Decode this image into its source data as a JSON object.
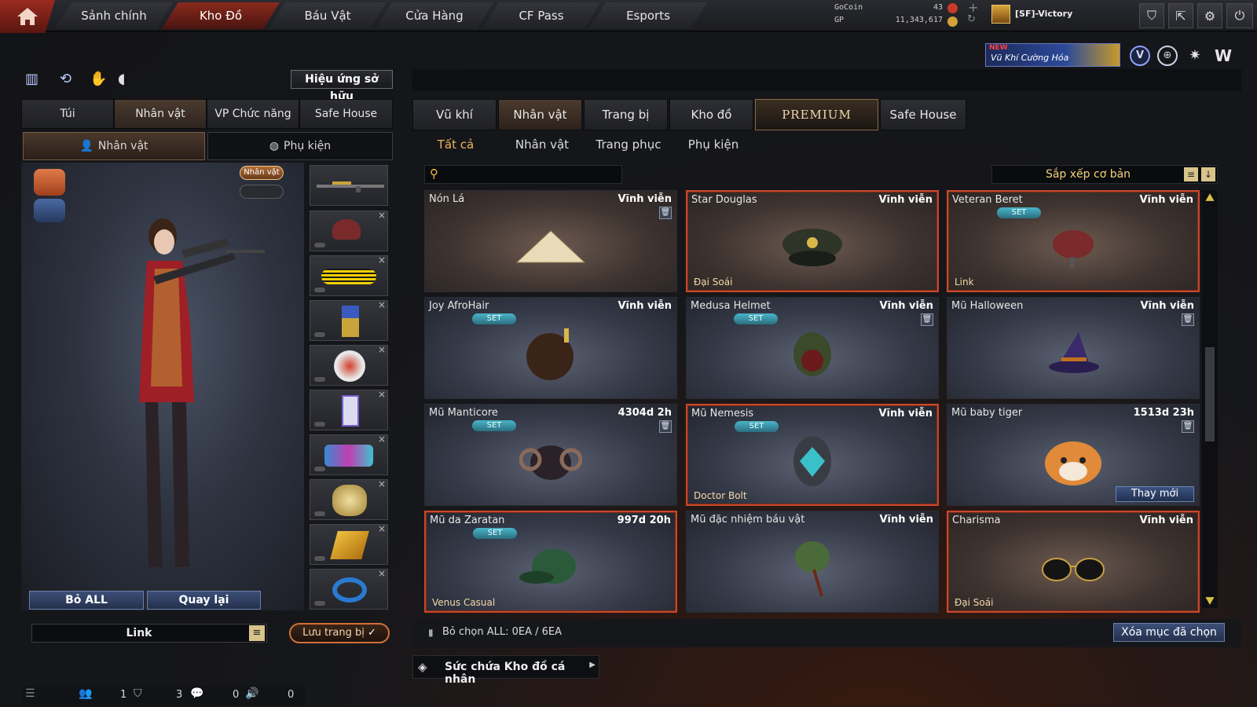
{
  "nav": {
    "tabs": [
      "Sảnh chính",
      "Kho Đồ",
      "Báu Vật",
      "Cửa Hàng",
      "CF Pass",
      "Esports"
    ],
    "active": "Kho Đồ"
  },
  "currency": {
    "gocoin_label": "GoCoin",
    "gocoin_value": "43",
    "gp_label": "GP",
    "gp_value": "11,343,617"
  },
  "user": {
    "name": "[SF]-Victory"
  },
  "banner": {
    "badge": "NEW",
    "text": "Vũ Khí Cường Hóa"
  },
  "left": {
    "effect_button": "Hiệu ứng sở hữu",
    "tabs": [
      "Túi",
      "Nhân vật",
      "VP Chức năng",
      "Safe House"
    ],
    "subtabs": [
      "Nhân vật",
      "Phụ kiện"
    ],
    "char_badge": "Nhân vật",
    "btn_remove_all": "Bỏ ALL",
    "btn_back": "Quay lại",
    "preset_label": "Link",
    "save_label": "Lưu trang bị"
  },
  "right": {
    "tabs": [
      "Vũ khí",
      "Nhân vật",
      "Trang bị",
      "Kho đồ",
      "PREMIUM",
      "Safe House"
    ],
    "subtabs": [
      "Tất cả",
      "Nhân vật",
      "Trang phục",
      "Phụ kiện"
    ],
    "search_placeholder": "",
    "sort_label": "Sắp xếp cơ bản",
    "select_all_text": "Bỏ chọn ALL: 0EA / 6EA",
    "delete_selected": "Xóa mục đã chọn",
    "capacity_label": "Sức chứa Kho đồ cá nhân"
  },
  "items": [
    {
      "name": "Nón Lá",
      "duration": "Vĩnh viễn",
      "set": "",
      "sub": "",
      "trash": true,
      "selected": false,
      "bg": "brown",
      "icon": "conical-hat-icon"
    },
    {
      "name": "Star Douglas",
      "duration": "Vĩnh viễn",
      "set": "",
      "sub": "Đại Soái",
      "trash": false,
      "selected": true,
      "bg": "brown",
      "icon": "officer-cap-icon"
    },
    {
      "name": "Veteran Beret",
      "duration": "Vĩnh viễn",
      "set": "SET",
      "sub": "Link",
      "trash": false,
      "selected": true,
      "bg": "brown",
      "icon": "beret-icon"
    },
    {
      "name": "Joy AfroHair",
      "duration": "Vĩnh viễn",
      "set": "SET",
      "sub": "",
      "trash": false,
      "selected": false,
      "bg": "blue",
      "icon": "afro-hair-icon"
    },
    {
      "name": "Medusa Helmet",
      "duration": "Vĩnh viễn",
      "set": "SET",
      "sub": "",
      "trash": true,
      "selected": false,
      "bg": "blue",
      "icon": "medusa-helmet-icon"
    },
    {
      "name": "Mũ Halloween",
      "duration": "Vĩnh viễn",
      "set": "",
      "sub": "",
      "trash": true,
      "selected": false,
      "bg": "blue",
      "icon": "witch-hat-icon"
    },
    {
      "name": "Mũ Manticore",
      "duration": "4304d 2h",
      "set": "SET",
      "sub": "",
      "trash": true,
      "selected": false,
      "bg": "blue",
      "icon": "manticore-helmet-icon"
    },
    {
      "name": "Mũ Nemesis",
      "duration": "Vĩnh viễn",
      "set": "SET",
      "sub": "Doctor Bolt",
      "trash": false,
      "selected": true,
      "bg": "blue",
      "icon": "nemesis-helmet-icon"
    },
    {
      "name": "Mũ baby tiger",
      "duration": "1513d 23h",
      "set": "",
      "sub": "",
      "trash": true,
      "selected": false,
      "bg": "blue",
      "icon": "tiger-hat-icon",
      "renew": "Thay mới"
    },
    {
      "name": "Mũ da Zaratan",
      "duration": "997d 20h",
      "set": "SET",
      "sub": "Venus Casual",
      "trash": false,
      "selected": true,
      "bg": "blue",
      "icon": "camo-cap-icon"
    },
    {
      "name": "Mũ đặc nhiệm báu vật",
      "duration": "Vĩnh viễn",
      "set": "",
      "sub": "",
      "trash": false,
      "selected": false,
      "bg": "blue",
      "icon": "bandana-icon"
    },
    {
      "name": "Charisma",
      "duration": "Vĩnh viễn",
      "set": "",
      "sub": "Đại Soái",
      "trash": false,
      "selected": true,
      "bg": "brown",
      "icon": "sunglasses-icon"
    }
  ],
  "statusbar": {
    "friends": "1",
    "clan": "3",
    "chat": "0",
    "volume": "0"
  }
}
